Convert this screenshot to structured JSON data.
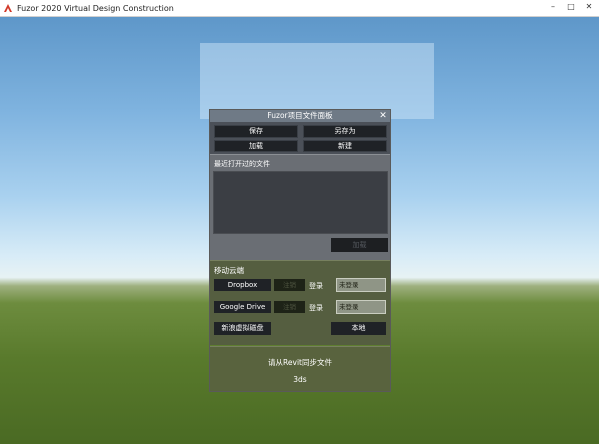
{
  "window": {
    "title": "Fuzor 2020 Virtual Design Construction",
    "minimize": "–",
    "maximize": "□",
    "close": "✕"
  },
  "panel": {
    "title": "Fuzor项目文件面板",
    "close": "✕",
    "buttons": {
      "save": "保存",
      "save_as": "另存为",
      "load": "加载",
      "new": "新建"
    },
    "recent": {
      "label": "最近打开过的文件",
      "load_button": "加载"
    },
    "cloud": {
      "label": "移动云端",
      "dropbox": {
        "name": "Dropbox",
        "logout": "注销",
        "login": "登录",
        "status": "未登录"
      },
      "google_drive": {
        "name": "Google Drive",
        "logout": "注销",
        "login": "登录",
        "status": "未登录"
      },
      "sina_disk": "新浪虚拟磁盘",
      "local": "本地"
    },
    "sync": {
      "message": "请从Revit同步文件",
      "format": "3ds"
    }
  }
}
